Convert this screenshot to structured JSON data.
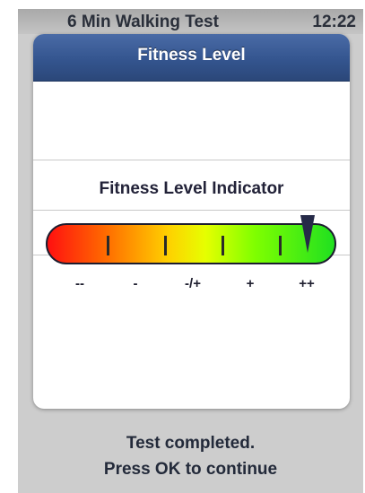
{
  "status_bar": {
    "app_title": "6 Min Walking Test",
    "time": "12:22"
  },
  "dialog": {
    "title": "Fitness Level",
    "indicator_label": "Fitness Level Indicator",
    "scale_labels": [
      "--",
      "-",
      "-/+",
      "+",
      "++"
    ],
    "level_fraction": 0.9
  },
  "footer": {
    "line1": "Test completed.",
    "line2": "Press OK to continue"
  },
  "colors": {
    "header_blue": "#34558f",
    "background_gray": "#cdcdcd",
    "pointer": "#262a48"
  }
}
